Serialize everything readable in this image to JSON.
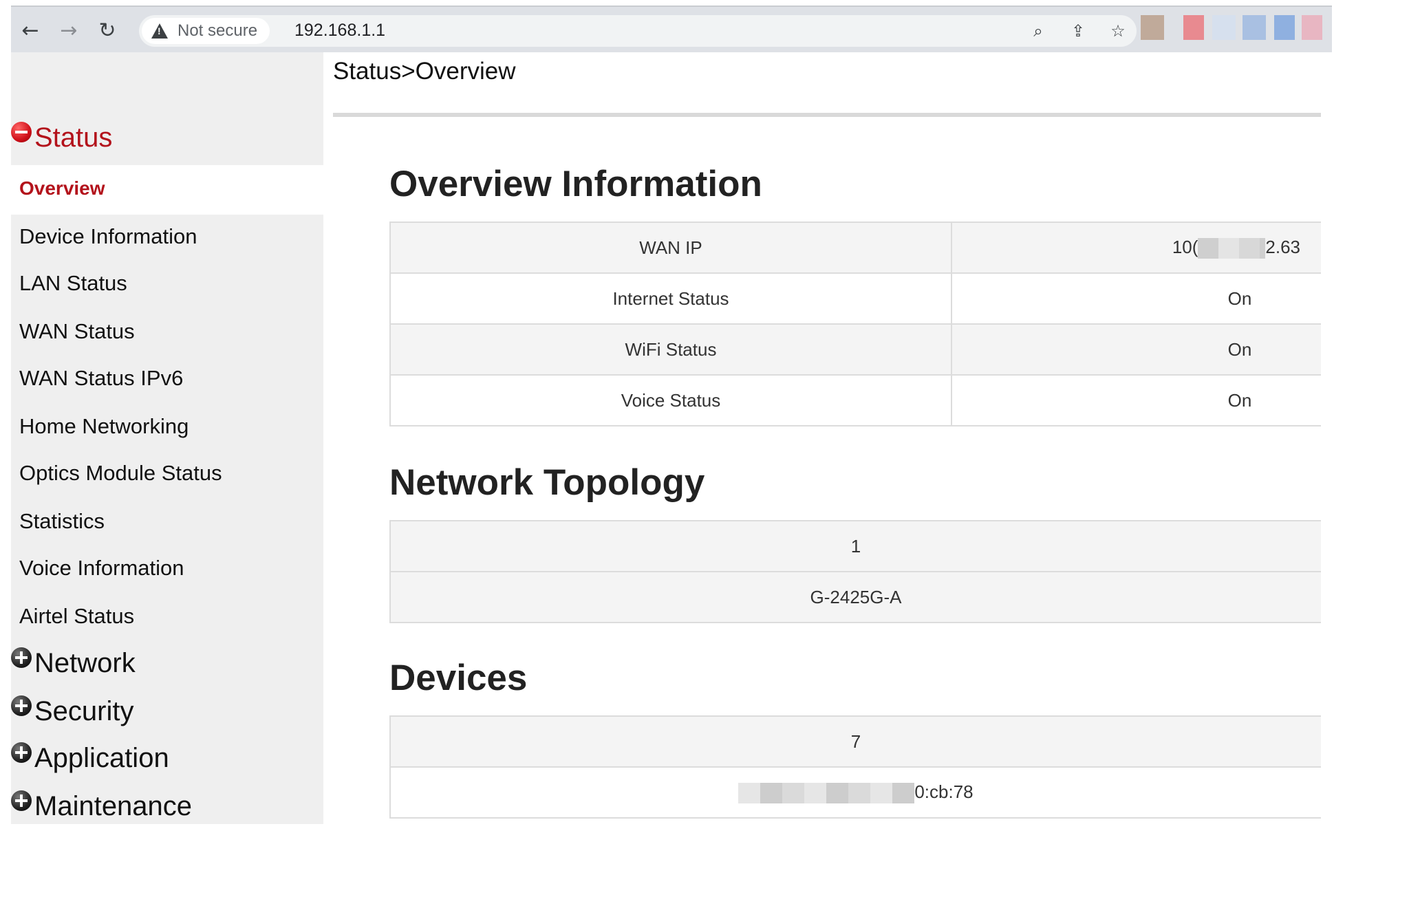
{
  "browser": {
    "back_glyph": "←",
    "forward_glyph": "→",
    "reload_glyph": "↻",
    "security_label": "Not secure",
    "url": "192.168.1.1",
    "zoom_glyph": "⌕",
    "share_glyph": "⇪",
    "star_glyph": "☆"
  },
  "sidebar": {
    "status_label": "Status",
    "active_item": "Overview",
    "status_items": [
      "Device Information",
      "LAN Status",
      "WAN Status",
      "WAN Status IPv6",
      "Home Networking",
      "Optics Module Status",
      "Statistics",
      "Voice Information",
      "Airtel Status"
    ],
    "sections": [
      "Network",
      "Security",
      "Application",
      "Maintenance"
    ]
  },
  "main": {
    "breadcrumb": "Status>Overview",
    "overview": {
      "title": "Overview Information",
      "rows": [
        {
          "label": "WAN IP",
          "value_prefix": "10(",
          "value_suffix": "2.63"
        },
        {
          "label": "Internet Status",
          "value": "On"
        },
        {
          "label": "WiFi Status",
          "value": "On"
        },
        {
          "label": "Voice Status",
          "value": "On"
        }
      ]
    },
    "topology": {
      "title": "Network Topology",
      "count": "1",
      "device": "G-2425G-A"
    },
    "devices": {
      "title": "Devices",
      "count": "7",
      "mac_suffix": "0:cb:78"
    }
  },
  "colors": {
    "accent_red": "#b3121b",
    "sidebar_bg": "#efefef",
    "chrome_bg": "#dee1e6"
  }
}
